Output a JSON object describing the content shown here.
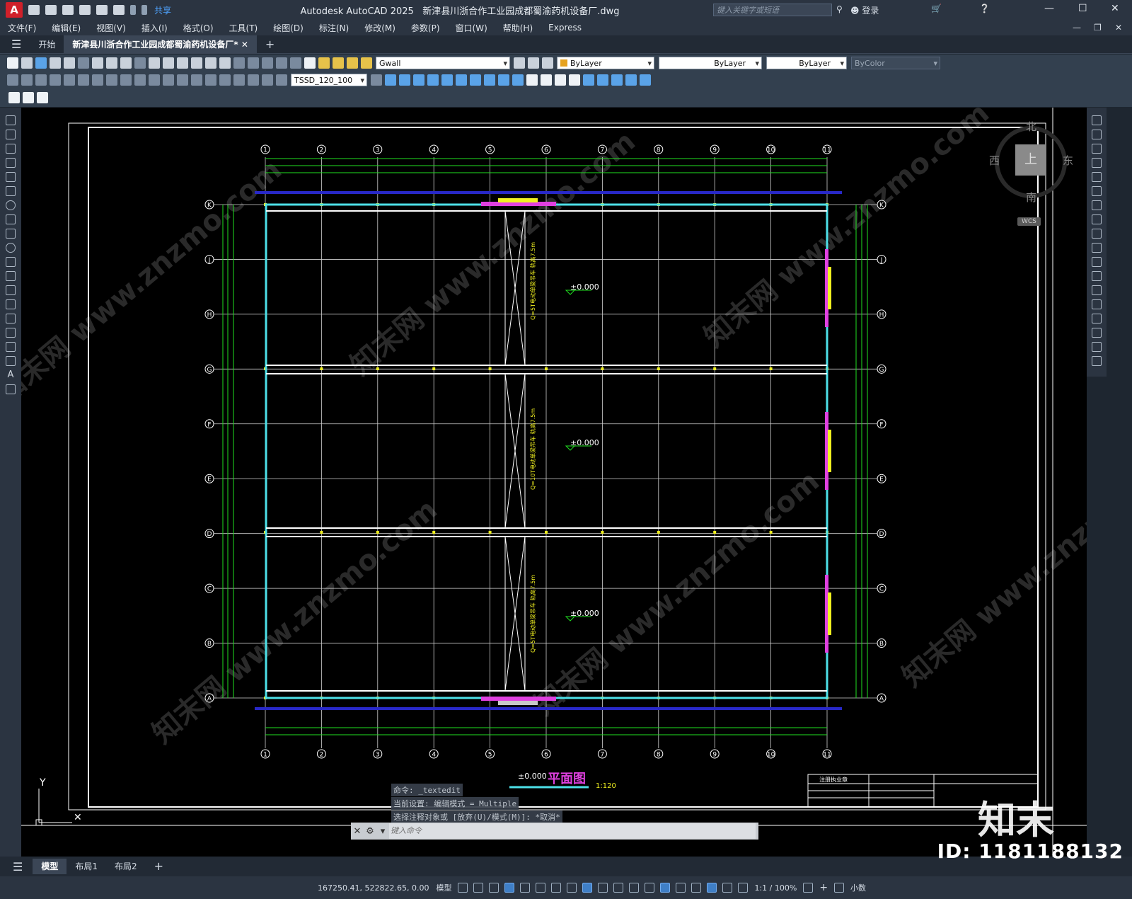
{
  "app": {
    "title": "Autodesk AutoCAD 2025",
    "filename": "新津县川浙合作工业园成都蜀渝药机设备厂.dwg",
    "share_label": "共享",
    "search_placeholder": "键入关键字或短语",
    "login_label": "登录"
  },
  "menu": [
    "文件(F)",
    "编辑(E)",
    "视图(V)",
    "插入(I)",
    "格式(O)",
    "工具(T)",
    "绘图(D)",
    "标注(N)",
    "修改(M)",
    "参数(P)",
    "窗口(W)",
    "帮助(H)",
    "Express"
  ],
  "tabs": {
    "start": "开始",
    "doc": "新津县川浙合作工业园成都蜀渝药机设备厂*",
    "add": "+"
  },
  "toolbar": {
    "layer": "Gwall",
    "color": "ByLayer",
    "linetype": "ByLayer",
    "lineweight": "ByLayer",
    "plotstyle": "ByColor",
    "dimstyle": "TSSD_120_100"
  },
  "viewcube": {
    "north": "北",
    "south": "南",
    "east": "东",
    "west": "西",
    "top": "上",
    "wcs": "WCS"
  },
  "drawing": {
    "grid_top": [
      "1",
      "2",
      "3",
      "4",
      "5",
      "6",
      "7",
      "8",
      "9",
      "10",
      "11"
    ],
    "grid_side": [
      "K",
      "J",
      "H",
      "G",
      "F",
      "E",
      "D",
      "C",
      "B",
      "A"
    ],
    "elevation": "±0.000",
    "plan_title": "平面图",
    "plan_elev": "±0.000",
    "scale": "1:120",
    "crane1": "Q=5T电动单梁吊车 轨高7.5m",
    "crane2": "Q=10T电动单梁吊车 轨高7.5m",
    "crane3": "Q=5T电动单梁吊车 轨高7.5m",
    "axis_y": "Y",
    "titleblock_head": "注册执业章"
  },
  "command": {
    "history": [
      "命令: _textedit",
      "当前设置: 编辑模式 = Multiple",
      "选择注释对象或 [放弃(U)/模式(M)]: *取消*"
    ],
    "placeholder": "键入命令"
  },
  "layout_tabs": [
    "模型",
    "布局1",
    "布局2"
  ],
  "status": {
    "coords": "167250.41, 522822.65, 0.00",
    "mode": "模型",
    "scale": "1:1 / 100%",
    "units": "小数"
  },
  "overlay": {
    "id": "ID: 1181188132",
    "brand": "知末"
  }
}
